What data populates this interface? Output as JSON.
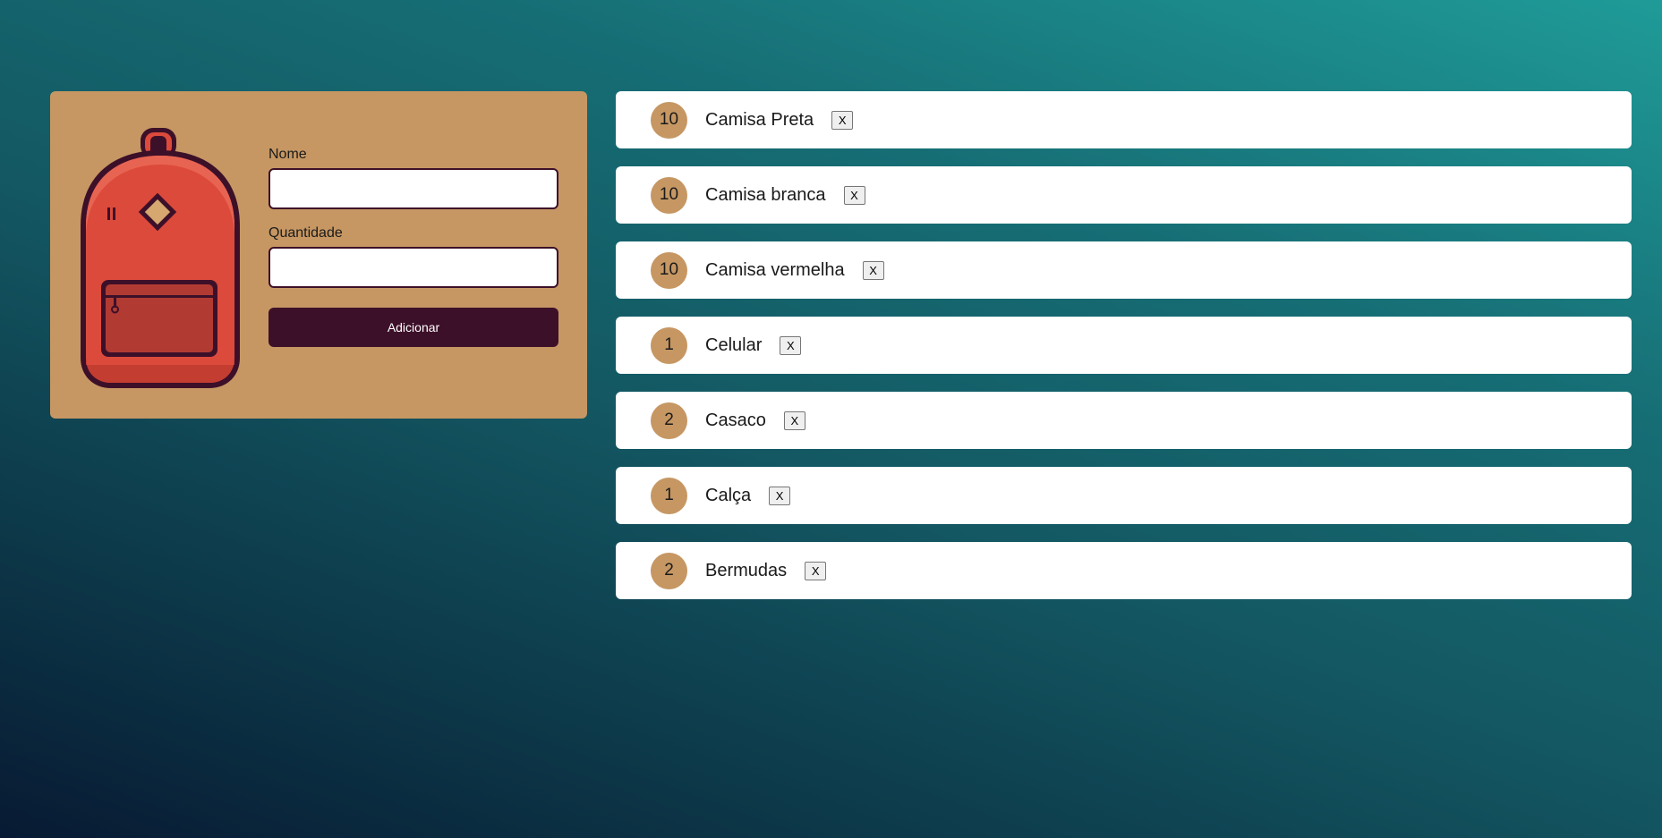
{
  "form": {
    "name_label": "Nome",
    "name_value": "",
    "quantity_label": "Quantidade",
    "quantity_value": "",
    "submit_label": "Adicionar"
  },
  "items": [
    {
      "quantity": "10",
      "name": "Camisa Preta",
      "remove_label": "X"
    },
    {
      "quantity": "10",
      "name": "Camisa branca",
      "remove_label": "X"
    },
    {
      "quantity": "10",
      "name": "Camisa vermelha",
      "remove_label": "X"
    },
    {
      "quantity": "1",
      "name": "Celular",
      "remove_label": "X"
    },
    {
      "quantity": "2",
      "name": "Casaco",
      "remove_label": "X"
    },
    {
      "quantity": "1",
      "name": "Calça",
      "remove_label": "X"
    },
    {
      "quantity": "2",
      "name": "Bermudas",
      "remove_label": "X"
    }
  ],
  "icons": {
    "illustration": "backpack-icon"
  },
  "colors": {
    "card_background": "#c69763",
    "accent_dark": "#3d1029",
    "backpack_red": "#dc4a3b",
    "badge": "#c69763"
  }
}
